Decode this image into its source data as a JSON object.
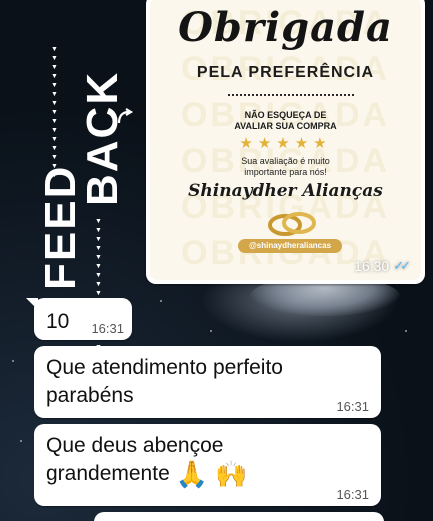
{
  "side_title": {
    "word1": "FEED",
    "word2": "BACK",
    "triangles": "▼▼▼▼▼▼▼▼▼▼▼▼▼▼▼"
  },
  "image_message": {
    "card": {
      "title": "Obrigada",
      "subtitle": "PELA PREFERÊNCIA",
      "remind_line1": "NÃO ESQUEÇA DE",
      "remind_line2": "AVALIAR SUA COMPRA",
      "stars": "★★★★★",
      "note_line1": "Sua avaliação é muito",
      "note_line2": "importante para nós!",
      "brand": "Shinaydher Alianças",
      "handle": "@shinaydheraliancas",
      "watermark": [
        "OBRIGADA",
        "OBRIGADA",
        "OBRIGADA",
        "OBRIGADA",
        "OBRIGADA",
        "OBRIGADA"
      ]
    },
    "time": "16:30",
    "ticks": "✓✓"
  },
  "messages": [
    {
      "text": "10",
      "time": "16:31"
    },
    {
      "line1": "Que atendimento perfeito",
      "line2": "parabéns",
      "time": "16:31"
    },
    {
      "line1": "Que deus abençoe",
      "line2": "grandemente",
      "emoji": "🙏 🙌",
      "time": "16:31"
    }
  ],
  "colors": {
    "accent_gold": "#d3a64a",
    "read_ticks": "#5bb8f0",
    "background": "#0b1219",
    "bubble": "#ffffff"
  }
}
